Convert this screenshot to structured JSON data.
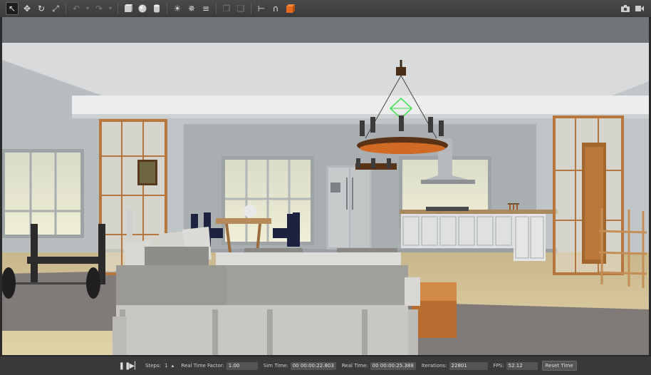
{
  "toolbar": {
    "tools": [
      "select-arrow-icon",
      "translate-icon",
      "rotate-icon",
      "scale-icon",
      "undo-icon",
      "undo-dropdown-icon",
      "redo-icon",
      "redo-dropdown-icon",
      "box-icon",
      "sphere-icon",
      "cylinder-icon",
      "point-light-icon",
      "spot-light-icon",
      "directional-light-icon",
      "copy-icon",
      "paste-icon",
      "align-icon",
      "snap-icon",
      "orange-cube-icon"
    ],
    "right_tools": [
      "screenshot-icon",
      "record-icon"
    ]
  },
  "status": {
    "steps_label": "Steps:",
    "steps_value": "1",
    "rtf_label": "Real Time Factor:",
    "rtf_value": "1.00",
    "sim_time_label": "Sim Time:",
    "sim_time_value": "00 00:00:22.803",
    "real_time_label": "Real Time:",
    "real_time_value": "00 00:00:25.388",
    "iterations_label": "Iterations:",
    "iterations_value": "22801",
    "fps_label": "FPS:",
    "fps_value": "52.12",
    "reset_label": "Reset Time"
  }
}
